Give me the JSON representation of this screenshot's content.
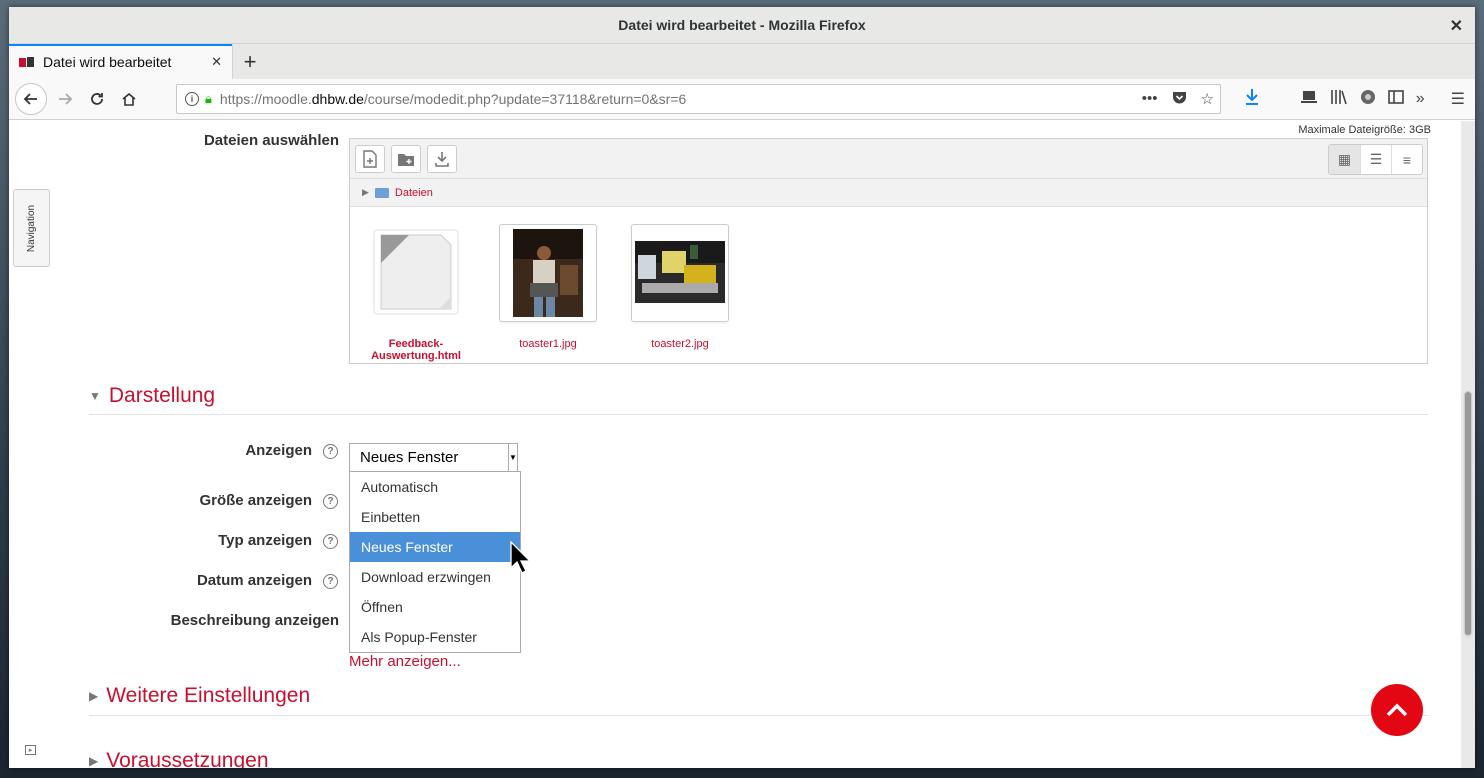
{
  "window": {
    "title": "Datei wird bearbeitet - Mozilla Firefox",
    "close": "✕"
  },
  "tab": {
    "label": "Datei wird bearbeitet",
    "close": "✕",
    "new": "+"
  },
  "nav": {
    "url_prefix": "https://moodle.",
    "url_host": "dhbw.de",
    "url_path": "/course/modedit.php?update=37118&return=0&sr=6"
  },
  "sidebar": {
    "navigation_label": "Navigation"
  },
  "files": {
    "label": "Dateien auswählen",
    "max_size": "Maximale Dateigröße: 3GB",
    "path": "Dateien",
    "items": [
      {
        "name": "Feedback-Auswertung.html",
        "icon": "html-file-icon"
      },
      {
        "name": "toaster1.jpg",
        "icon": "image-thumbnail"
      },
      {
        "name": "toaster2.jpg",
        "icon": "image-thumbnail"
      }
    ]
  },
  "darstellung": {
    "heading": "Darstellung",
    "fields": {
      "anzeigen": "Anzeigen",
      "groesse": "Größe anzeigen",
      "typ": "Typ anzeigen",
      "datum": "Datum anzeigen",
      "beschreibung": "Beschreibung anzeigen"
    },
    "select_value": "Neues Fenster",
    "options": [
      "Automatisch",
      "Einbetten",
      "Neues Fenster",
      "Download erzwingen",
      "Öffnen",
      "Als Popup-Fenster"
    ],
    "selected_index": 2,
    "more_link": "Mehr anzeigen..."
  },
  "sections": {
    "weitere": "Weitere Einstellungen",
    "voraussetzungen": "Voraussetzungen"
  },
  "colors": {
    "accent": "#c8102e",
    "highlight": "#4a90d9",
    "to_top": "#e30613"
  }
}
